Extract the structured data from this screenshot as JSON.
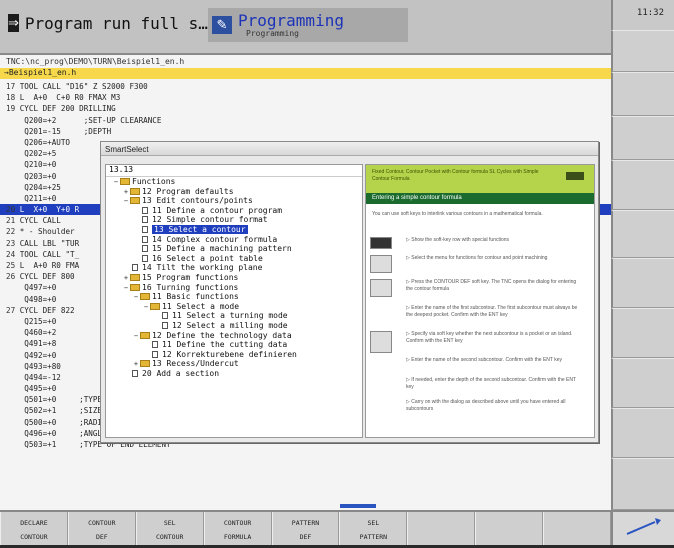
{
  "header": {
    "left_mode": {
      "icon": "run-icon",
      "title": "Program run full s…"
    },
    "right_mode": {
      "icon": "edit-icon",
      "title": "Programming",
      "subtitle": "Programming"
    }
  },
  "clock": "11:32",
  "editor": {
    "path": "TNC:\\nc_prog\\DEMO\\TURN\\Beispiel1_en.h",
    "file_tab": "→Beispiel1_en.h",
    "lines": [
      {
        "n": "17",
        "t": " TOOL CALL \"D16\" Z S2000 F300"
      },
      {
        "n": "18",
        "t": " L  A+0  C+0 R0 FMAX M3"
      },
      {
        "n": "19",
        "t": " CYCL DEF 200 DRILLING"
      },
      {
        "n": "",
        "t": "    Q200=+2      ;SET-UP CLEARANCE"
      },
      {
        "n": "",
        "t": "    Q201=-15     ;DEPTH"
      },
      {
        "n": "",
        "t": "    Q206=+AUTO"
      },
      {
        "n": "",
        "t": "    Q202=+5"
      },
      {
        "n": "",
        "t": "    Q210=+0"
      },
      {
        "n": "",
        "t": "    Q203=+0"
      },
      {
        "n": "",
        "t": "    Q204=+25"
      },
      {
        "n": "",
        "t": "    Q211=+0"
      },
      {
        "n": "20",
        "t": " L  X+0  Y+0 R",
        "hl": true
      },
      {
        "n": "21",
        "t": " CYCL CALL"
      },
      {
        "n": "22",
        "t": " * - Shoulder"
      },
      {
        "n": "23",
        "t": " CALL LBL \"TUR"
      },
      {
        "n": "24",
        "t": " TOOL CALL \"T_"
      },
      {
        "n": "25",
        "t": " L  A+0 R0 FMA"
      },
      {
        "n": "26",
        "t": " CYCL DEF 800"
      },
      {
        "n": "",
        "t": "    Q497=+0"
      },
      {
        "n": "",
        "t": "    Q498=+0"
      },
      {
        "n": "27",
        "t": " CYCL DEF 822"
      },
      {
        "n": "",
        "t": "    Q215=+0"
      },
      {
        "n": "",
        "t": "    Q460=+2"
      },
      {
        "n": "",
        "t": "    Q491=+8"
      },
      {
        "n": "",
        "t": "    Q492=+0"
      },
      {
        "n": "",
        "t": "    Q493=+80"
      },
      {
        "n": "",
        "t": "    Q494=-12"
      },
      {
        "n": "",
        "t": "    Q495=+0"
      },
      {
        "n": "",
        "t": "    Q501=+0     ;TYPE OF STARTING ELEMENT"
      },
      {
        "n": "",
        "t": "    Q502=+1     ;SIZE OF STARTING ELEMENT"
      },
      {
        "n": "",
        "t": "    Q500=+0     ;RADIUS OF CONTOUR EDGE"
      },
      {
        "n": "",
        "t": "    Q496=+0     ;ANGLE OF CIRCUM. SURFACE"
      },
      {
        "n": "",
        "t": "    Q503=+1     ;TYPE OF END ELEMENT"
      }
    ]
  },
  "smartselect": {
    "title": "SmartSelect",
    "address": "13.13",
    "tree": [
      {
        "depth": 0,
        "tog": "−",
        "icon": "folder",
        "label": "Functions"
      },
      {
        "depth": 1,
        "tog": "+",
        "icon": "folder",
        "label": "12 Program defaults"
      },
      {
        "depth": 1,
        "tog": "−",
        "icon": "folder",
        "label": "13 Edit contours/points"
      },
      {
        "depth": 2,
        "tog": "",
        "icon": "doc",
        "label": "11 Define a contour program"
      },
      {
        "depth": 2,
        "tog": "",
        "icon": "doc",
        "label": "12 Simple contour format"
      },
      {
        "depth": 2,
        "tog": "",
        "icon": "doc",
        "label": "13 Select a contour",
        "sel": true
      },
      {
        "depth": 2,
        "tog": "",
        "icon": "doc",
        "label": "14 Complex contour formula"
      },
      {
        "depth": 2,
        "tog": "",
        "icon": "doc",
        "label": "15 Define a machining pattern"
      },
      {
        "depth": 2,
        "tog": "",
        "icon": "doc",
        "label": "16 Select a point table"
      },
      {
        "depth": 1,
        "tog": "",
        "icon": "doc",
        "label": "14 Tilt the working plane"
      },
      {
        "depth": 1,
        "tog": "+",
        "icon": "folder",
        "label": "15 Program functions"
      },
      {
        "depth": 1,
        "tog": "−",
        "icon": "folder",
        "label": "16 Turning functions"
      },
      {
        "depth": 2,
        "tog": "−",
        "icon": "folder",
        "label": "11 Basic functions"
      },
      {
        "depth": 3,
        "tog": "−",
        "icon": "folder",
        "label": "11 Select a mode"
      },
      {
        "depth": 4,
        "tog": "",
        "icon": "doc",
        "label": "11 Select a turning mode"
      },
      {
        "depth": 4,
        "tog": "",
        "icon": "doc",
        "label": "12 Select a milling mode"
      },
      {
        "depth": 2,
        "tog": "−",
        "icon": "folder",
        "label": "12 Define the technology data"
      },
      {
        "depth": 3,
        "tog": "",
        "icon": "doc",
        "label": "11 Define the cutting data"
      },
      {
        "depth": 3,
        "tog": "",
        "icon": "doc",
        "label": "12 Korrekturebene definieren"
      },
      {
        "depth": 2,
        "tog": "+",
        "icon": "folder",
        "label": "13 Recess/Undercut"
      },
      {
        "depth": 1,
        "tog": "",
        "icon": "doc",
        "label": "20 Add a section"
      }
    ],
    "help": {
      "top_text": "Fixed Contour, Contour Pocket with Contour formula SL Cycles with Simple Contour Formula",
      "heading": "Entering a simple contour formula",
      "intro": "You can use soft keys to interlink various contours in a mathematical formula.",
      "steps": [
        "▷ Show the soft-key row with special functions",
        "▷ Select the menu for functions for contour and point machining",
        "▷ Press the CONTOUR DEF soft key. The TNC opens the dialog for entering the contour formula",
        "▷ Enter the name of the first subcontour. The first subcontour must always be the deepest pocket. Confirm with the ENT key",
        "▷ Specify via soft key whether the next subcontour is a pocket or an island. Confirm with the ENT key",
        "▷ Enter the name of the second subcontour. Confirm with the ENT key",
        "▷ If needed, enter the depth of the second subcontour. Confirm with the ENT key",
        "▷ Carry on with the dialog as described above until you have entered all subcontours"
      ]
    }
  },
  "softkeys": [
    {
      "l1": "DECLARE",
      "l2": "CONTOUR"
    },
    {
      "l1": "CONTOUR",
      "l2": "DEF"
    },
    {
      "l1": "SEL",
      "l2": "CONTOUR"
    },
    {
      "l1": "CONTOUR",
      "l2": "FORMULA"
    },
    {
      "l1": "PATTERN",
      "l2": "DEF"
    },
    {
      "l1": "SEL",
      "l2": "PATTERN"
    },
    {
      "l1": "",
      "l2": ""
    },
    {
      "l1": "",
      "l2": ""
    },
    {
      "l1": "",
      "l2": ""
    }
  ]
}
